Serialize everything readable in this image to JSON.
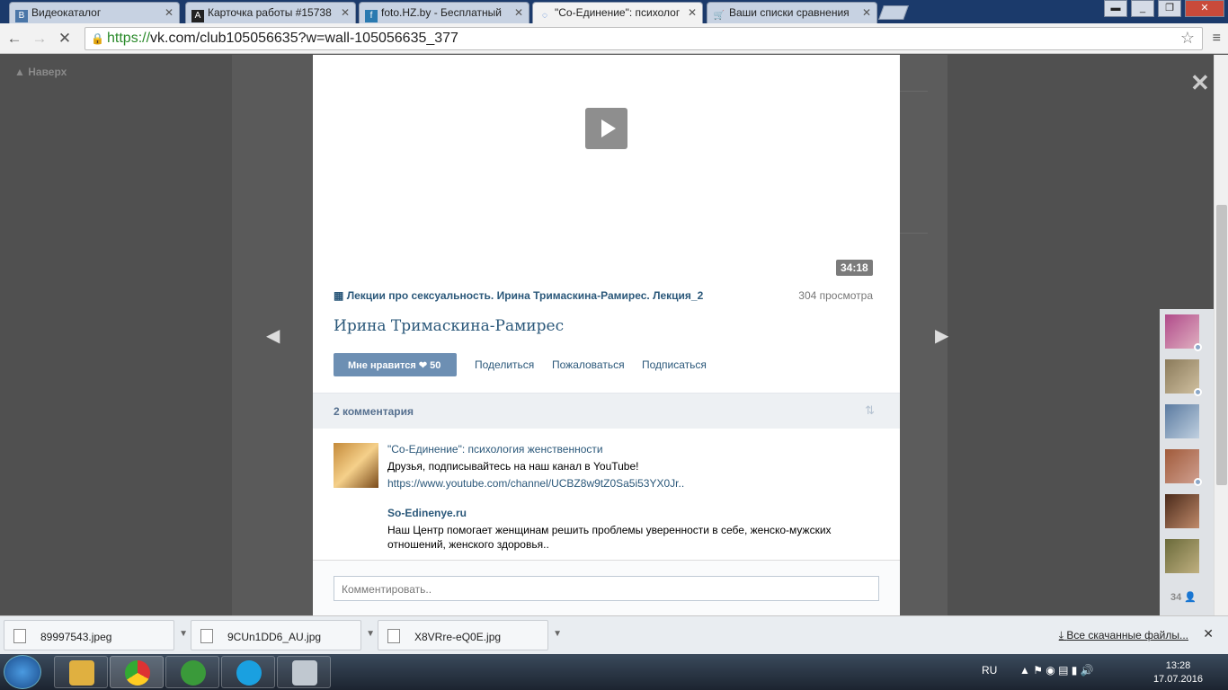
{
  "browser": {
    "tabs": [
      {
        "title": "Видеокаталог",
        "icon": "vk-icon",
        "active": false
      },
      {
        "title": "Карточка работы #15738",
        "icon": "a-icon",
        "active": false
      },
      {
        "title": "foto.HZ.by - Бесплатный",
        "icon": "foto-icon",
        "active": false
      },
      {
        "title": "\"Со-Единение\": психолог",
        "icon": "loading-icon",
        "active": true
      },
      {
        "title": "Ваши списки сравнения",
        "icon": "cart-icon",
        "active": false
      }
    ],
    "url_https": "https://",
    "url_rest": "vk.com/club105056635?w=wall-105056635_377"
  },
  "page": {
    "back_to_top": "Наверх"
  },
  "video": {
    "duration": "34:18",
    "title": "Лекции про сексуальность. Ирина Тримаскина-Рамирес. Лекция_2",
    "views": "304 просмотра",
    "author": "Ирина Тримаскина-Рамирес",
    "like_label": "Мне нравится",
    "like_count": "50",
    "actions": {
      "share": "Поделиться",
      "report": "Пожаловаться",
      "subscribe": "Подписаться"
    }
  },
  "comments": {
    "header": "2 комментария",
    "items": [
      {
        "author": "\"Со-Единение\": психология женственности",
        "text": "Друзья, подписывайтесь на наш канал в YouTube!",
        "link": "https://www.youtube.com/channel/UCBZ8w9tZ0Sa5i53YX0Jr..",
        "site": "So-Edinenye.ru",
        "desc": "Наш Центр помогает женщинам решить проблемы уверенности в себе, женско-мужских отношений, женского здоровья.."
      }
    ],
    "input_placeholder": "Комментировать.."
  },
  "friends": {
    "count": "34"
  },
  "downloads": {
    "items": [
      {
        "name": "89997543.jpeg"
      },
      {
        "name": "9CUn1DD6_AU.jpg"
      },
      {
        "name": "X8VRre-eQ0E.jpg"
      }
    ],
    "all_label": "Все скачанные файлы..."
  },
  "taskbar": {
    "lang": "RU",
    "time": "13:28",
    "date": "17.07.2016"
  }
}
